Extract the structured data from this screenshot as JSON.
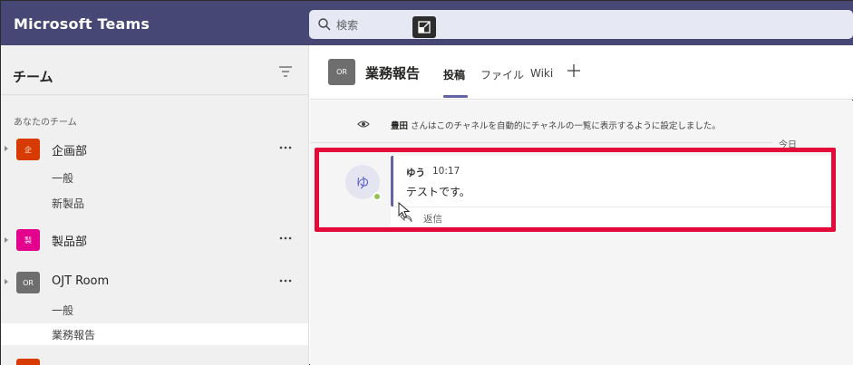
{
  "app": {
    "title": "Microsoft Teams"
  },
  "search": {
    "placeholder": "検索"
  },
  "sidebar": {
    "title": "チーム",
    "section_label": "あなたのチーム",
    "teams": [
      {
        "avatar": "企",
        "name": "企画部",
        "color": "#d83b01",
        "channels": [
          "一般",
          "新製品"
        ]
      },
      {
        "avatar": "製",
        "name": "製品部",
        "color": "#e3008c",
        "channels": []
      },
      {
        "avatar": "OR",
        "name": "OJT Room",
        "color": "#6e6e6e",
        "channels": [
          "一般",
          "業務報告"
        ]
      }
    ]
  },
  "channel": {
    "avatar": "OR",
    "title": "業務報告",
    "tabs": [
      "投稿",
      "ファイル",
      "Wiki"
    ]
  },
  "feed": {
    "system_message": {
      "actor": "豊田",
      "text": " さんはこのチャネルを自動的にチャネルの一覧に表示するように設定しました。"
    },
    "date_label": "今日",
    "message": {
      "avatar": "ゆ",
      "author": "ゆう",
      "time": "10:17",
      "body": "テストです。"
    },
    "reply_label": "返信"
  },
  "colors": {
    "brand": "#464775",
    "accent": "#6264a7",
    "highlight": "#e30a3a",
    "presence": "#92c353"
  }
}
